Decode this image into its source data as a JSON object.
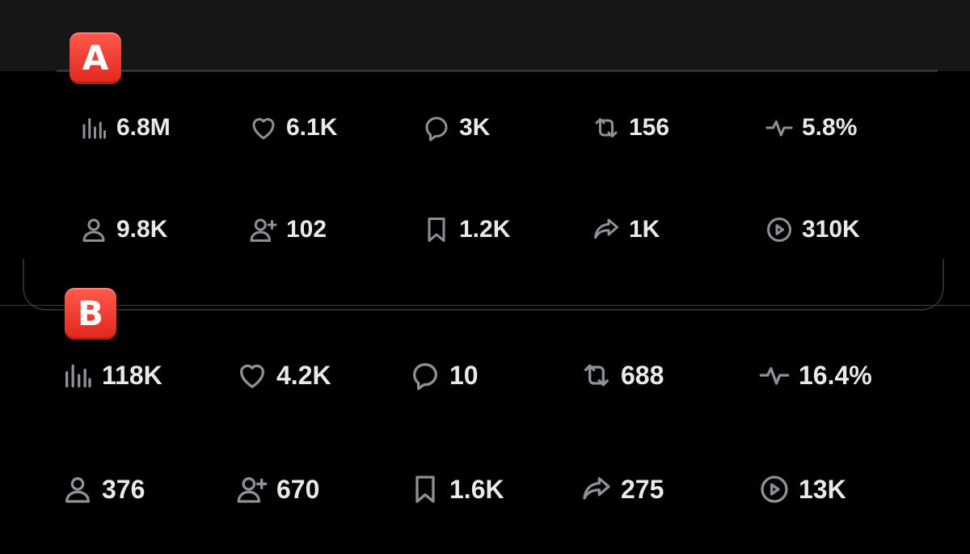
{
  "sections": [
    {
      "badge": "A",
      "stats": [
        {
          "icon": "views-icon",
          "value": "6.8M"
        },
        {
          "icon": "heart-icon",
          "value": "6.1K"
        },
        {
          "icon": "reply-icon",
          "value": "3K"
        },
        {
          "icon": "repost-icon",
          "value": "156"
        },
        {
          "icon": "engagement-rate-icon",
          "value": "5.8%"
        },
        {
          "icon": "profile-icon",
          "value": "9.8K"
        },
        {
          "icon": "follow-icon",
          "value": "102"
        },
        {
          "icon": "bookmark-icon",
          "value": "1.2K"
        },
        {
          "icon": "share-icon",
          "value": "1K"
        },
        {
          "icon": "video-play-icon",
          "value": "310K"
        }
      ]
    },
    {
      "badge": "B",
      "stats": [
        {
          "icon": "views-icon",
          "value": "118K"
        },
        {
          "icon": "heart-icon",
          "value": "4.2K"
        },
        {
          "icon": "reply-icon",
          "value": "10"
        },
        {
          "icon": "repost-icon",
          "value": "688"
        },
        {
          "icon": "engagement-rate-icon",
          "value": "16.4%"
        },
        {
          "icon": "profile-icon",
          "value": "376"
        },
        {
          "icon": "follow-icon",
          "value": "670"
        },
        {
          "icon": "bookmark-icon",
          "value": "1.6K"
        },
        {
          "icon": "share-icon",
          "value": "275"
        },
        {
          "icon": "video-play-icon",
          "value": "13K"
        }
      ]
    }
  ],
  "colors": {
    "background": "#000000",
    "top_strip": "#161616",
    "icon": "#8b9196",
    "value_text": "#e7e9ea",
    "badge": "#e8352b"
  }
}
